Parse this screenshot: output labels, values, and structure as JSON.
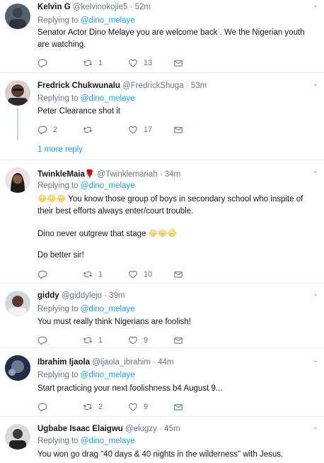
{
  "tweets": [
    {
      "name": "Kelvin G",
      "handle": "@kelvinokojie5",
      "time": "52m",
      "replying_label": "Replying to",
      "replying_to": "@dino_melaye",
      "text": "Senator Actor Dino Melaye you are welcome back . We the Nigerian youth are watching.",
      "replies": "",
      "retweets": "1",
      "likes": "13"
    },
    {
      "name": "Fredrick Chukwunalu",
      "handle": "@FredrickShuga",
      "time": "53m",
      "replying_label": "Replying to",
      "replying_to": "@dino_melaye",
      "text": "Peter Clearance shot it",
      "replies": "2",
      "retweets": "",
      "likes": "17",
      "more_reply": "1 more reply"
    },
    {
      "name": "TwinkleMaia",
      "name_suffix": "🌹",
      "handle": "@Twinklemariah",
      "time": "34m",
      "replying_label": "Replying to",
      "replying_to": "@dino_melaye",
      "emoji_lead": "😂😂😂",
      "text_line1": " You know those group of boys in secondary school who inspite of their best efforts always enter/court trouble.",
      "text_line2": "Dino never outgrew that stage ",
      "emoji_trail": "😂😂😂",
      "text_line3": "Do better sir!",
      "replies": "",
      "retweets": "1",
      "likes": "10"
    },
    {
      "name": "giddy",
      "handle": "@giddylejo",
      "time": "39m",
      "replying_label": "Replying to",
      "replying_to": "@dino_melaye",
      "text": "You must really think Nigerians are foolish!",
      "replies": "",
      "retweets": "1",
      "likes": "9"
    },
    {
      "name": "Ibrahim Ijaola",
      "handle": "@ijaola_ibrahim",
      "time": "44m",
      "replying_label": "Replying to",
      "replying_to": "@dino_melaye",
      "text": "Start practicing your next foolishness  b4 August 9...",
      "replies": "",
      "retweets": "2",
      "likes": "9"
    },
    {
      "name": "Ugbabe Isaac Elaigwu",
      "handle": "@elugzy",
      "time": "45m",
      "replying_label": "Replying to",
      "replying_to": "@dino_melaye",
      "text": "You won go drag \"40 days & 40 nights in the wilderness\" with Jesus."
    }
  ],
  "separator": "·",
  "caret_glyph": "⌄",
  "colors": {
    "accent": "#1da1f2",
    "secondary_text": "#657786",
    "primary_text": "#14171a",
    "divider": "#e6ecf0"
  },
  "icons": [
    "reply-icon",
    "retweet-icon",
    "like-icon",
    "direct-message-icon",
    "chevron-down-icon"
  ]
}
